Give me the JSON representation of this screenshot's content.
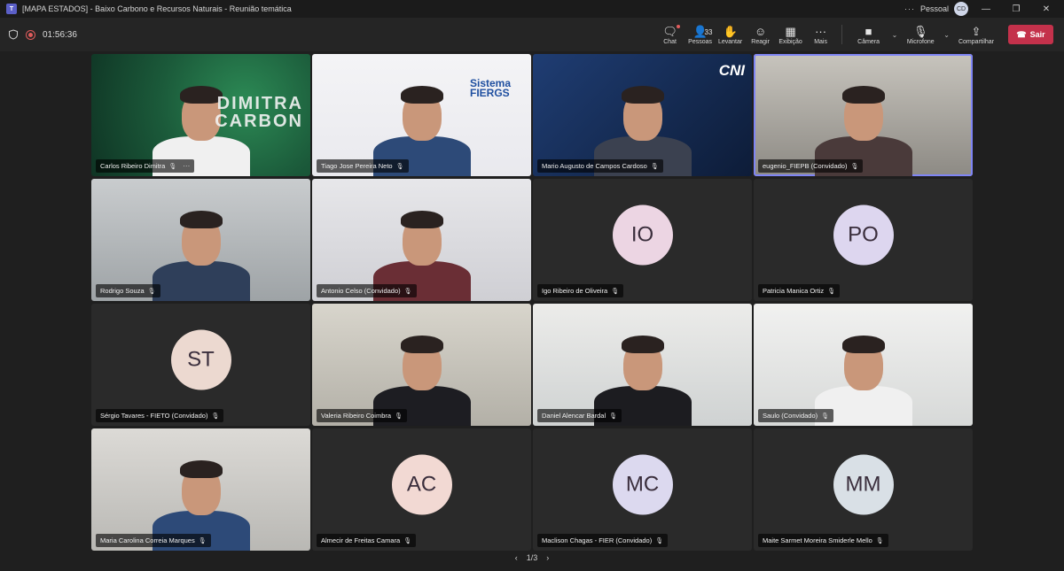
{
  "window": {
    "title": "[MAPA ESTADOS] - Baixo Carbono e Recursos Naturais - Reunião temática",
    "profile_label": "Pessoal",
    "profile_initials": "CD"
  },
  "meeting": {
    "timer": "01:56:36"
  },
  "toolbar": {
    "chat": "Chat",
    "people": "Pessoas",
    "people_count": "33",
    "raise": "Levantar",
    "react": "Reagir",
    "view": "Exibição",
    "more": "Mais",
    "camera": "Câmera",
    "mic": "Microfone",
    "share": "Compartilhar",
    "leave": "Sair"
  },
  "participants": [
    {
      "name": "Carlos Ribeiro Dimitra",
      "type": "video",
      "bg": "bg-green",
      "logo": "DIMITRA\nCARBON"
    },
    {
      "name": "Tiago Jose Pereira Neto",
      "type": "video",
      "bg": "bg-white",
      "logo": "Sistema FIERGS"
    },
    {
      "name": "Mario Augusto de Campos Cardoso",
      "type": "video",
      "bg": "bg-navy",
      "logo": "CNI"
    },
    {
      "name": "eugenio_FIEPB (Convidado)",
      "type": "video",
      "bg": "bg-office"
    },
    {
      "name": "Rodrigo Souza",
      "type": "video",
      "bg": "bg-grey1"
    },
    {
      "name": "Antonio Celso (Convidado)",
      "type": "video",
      "bg": "bg-wall"
    },
    {
      "name": "Igo Ribeiro de Oliveira",
      "type": "avatar",
      "initials": "IO",
      "avatar_color": "#ecd5e3"
    },
    {
      "name": "Patricia Manica Ortiz",
      "type": "avatar",
      "initials": "PO",
      "avatar_color": "#ddd6ef"
    },
    {
      "name": "Sérgio Tavares - FIETO (Convidado)",
      "type": "avatar",
      "initials": "ST",
      "avatar_color": "#ecd9d0"
    },
    {
      "name": "Valeria Ribeiro Coimbra",
      "type": "video",
      "bg": "bg-room"
    },
    {
      "name": "Daniel Alencar Bardal",
      "type": "video",
      "bg": "bg-light"
    },
    {
      "name": "Saulo (Convidado)",
      "type": "video",
      "bg": "bg-bright"
    },
    {
      "name": "Maria Carolina Correia Marques",
      "type": "video",
      "bg": "bg-desk"
    },
    {
      "name": "Almecir de Freitas Camara",
      "type": "avatar",
      "initials": "AC",
      "avatar_color": "#f2d9d3"
    },
    {
      "name": "Maclison Chagas - FIER (Convidado)",
      "type": "avatar",
      "initials": "MC",
      "avatar_color": "#dcd9ef"
    },
    {
      "name": "Maite Sarmet Moreira Smiderle Mello",
      "type": "avatar",
      "initials": "MM",
      "avatar_color": "#d9e0e6"
    }
  ],
  "pager": {
    "label": "1/3"
  },
  "colors": {
    "leave": "#c4314b",
    "active_border": "#7f85f5"
  }
}
